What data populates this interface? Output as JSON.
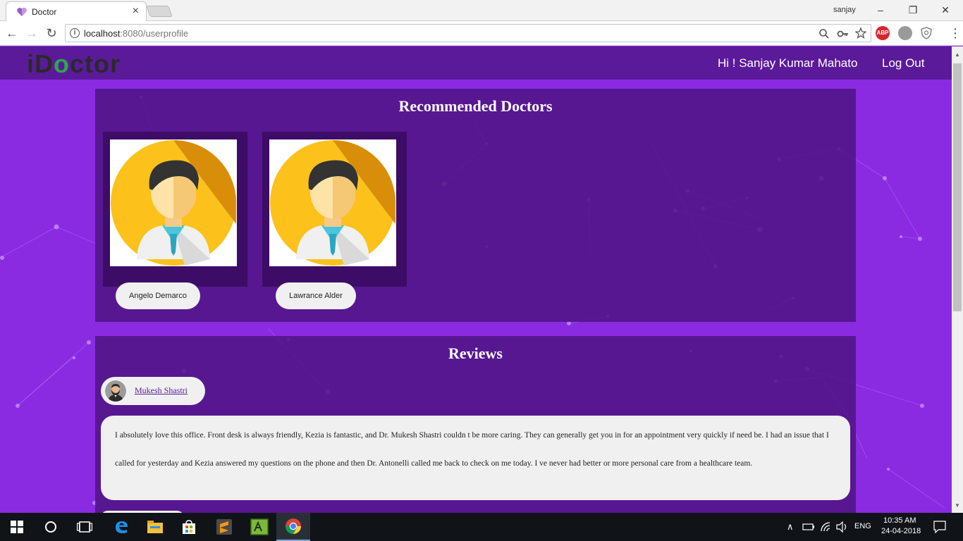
{
  "browser": {
    "tab_title": "Doctor",
    "tab_close": "×",
    "profile_name": "sanjay",
    "url_host": "localhost",
    "url_path": ":8080/userprofile",
    "abp_label": "ABP",
    "win_minimize": "–",
    "win_restore": "❐",
    "win_close": "✕",
    "back": "←",
    "forward": "→",
    "reload": "↻",
    "menu": "⋮"
  },
  "site": {
    "logo_prefix": "iD",
    "logo_o": "o",
    "logo_suffix": "ctor",
    "greeting": "Hi ! Sanjay Kumar Mahato",
    "logout": "Log Out"
  },
  "recommended": {
    "title": "Recommended Doctors",
    "doctors": [
      {
        "name": "Angelo Demarco"
      },
      {
        "name": "Lawrance Alder"
      }
    ]
  },
  "reviews": {
    "title": "Reviews",
    "items": [
      {
        "author": "Mukesh Shastri",
        "text": "I absolutely love this office. Front desk is always friendly, Kezia is fantastic, and Dr. Mukesh Shastri couldn t be more caring. They can generally get you in for an appointment very quickly if need be. I had an issue that I called for yesterday and Kezia answered my questions on the phone and then Dr. Antonelli called me back to check on me today. I ve never had better or more personal care from a healthcare team."
      }
    ]
  },
  "taskbar": {
    "lang": "ENG",
    "time": "10:35 AM",
    "date": "24-04-2018"
  },
  "icons": {
    "start": "windows-logo-icon",
    "search": "cortana-circle-icon",
    "taskview": "task-view-icon",
    "edge": "edge-icon",
    "explorer": "file-explorer-icon",
    "store": "store-icon",
    "sublime": "sublime-text-icon",
    "app": "green-app-icon",
    "chrome": "chrome-icon"
  }
}
